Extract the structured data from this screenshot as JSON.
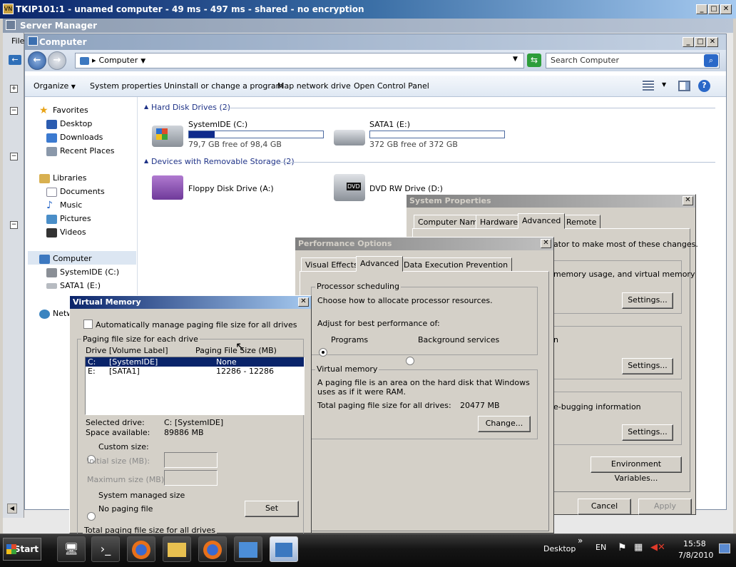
{
  "vnc": {
    "title": "TKIP101:1 - unamed computer - 49 ms - 497 ms - shared - no encryption",
    "logo": "VN"
  },
  "server_manager": {
    "title": "Server Manager",
    "menu_first": "File"
  },
  "explorer": {
    "title": "Computer",
    "address": "Computer",
    "search_placeholder": "Search Computer",
    "toolbar": {
      "organize": "Organize",
      "system_properties": "System properties",
      "uninstall": "Uninstall or change a program",
      "map_drive": "Map network drive",
      "control_panel": "Open Control Panel"
    },
    "nav": {
      "favorites": "Favorites",
      "desktop": "Desktop",
      "downloads": "Downloads",
      "recent": "Recent Places",
      "libraries": "Libraries",
      "documents": "Documents",
      "music": "Music",
      "pictures": "Pictures",
      "videos": "Videos",
      "computer": "Computer",
      "system_ide": "SystemIDE (C:)",
      "sata1": "SATA1 (E:)",
      "network": "Network"
    },
    "groups": {
      "hdd": "Hard Disk Drives (2)",
      "removable": "Devices with Removable Storage (2)"
    },
    "drives": {
      "c": {
        "name": "SystemIDE (C:)",
        "free": "79,7 GB free of 98,4 GB",
        "used_fraction": 0.19
      },
      "e": {
        "name": "SATA1 (E:)",
        "free": "372 GB free of 372 GB",
        "used_fraction": 0.0
      },
      "floppy": {
        "name": "Floppy Disk Drive (A:)"
      },
      "dvd": {
        "name": "DVD RW Drive (D:)",
        "badge": "DVD"
      }
    }
  },
  "system_properties": {
    "title": "System Properties",
    "tabs": [
      "Computer Name",
      "Hardware",
      "Advanced",
      "Remote"
    ],
    "admin_text": "ator to make most of these changes.",
    "perf_text": "memory usage, and virtual memory",
    "startup_text": "n",
    "debug_text": "e-bugging information",
    "settings": "Settings...",
    "env_vars": "Environment Variables...",
    "cancel": "Cancel",
    "apply": "Apply"
  },
  "performance_options": {
    "title": "Performance Options",
    "tabs": [
      "Visual Effects",
      "Advanced",
      "Data Execution Prevention"
    ],
    "proc_legend": "Processor scheduling",
    "proc_desc": "Choose how to allocate processor resources.",
    "adjust": "Adjust for best performance of:",
    "programs": "Programs",
    "background": "Background services",
    "vm_legend": "Virtual memory",
    "vm_desc": "A paging file is an area on the hard disk that Windows uses as if it were RAM.",
    "total_label": "Total paging file size for all drives:",
    "total_value": "20477 MB",
    "change": "Change..."
  },
  "virtual_memory": {
    "title": "Virtual Memory",
    "auto_manage": "Automatically manage paging file size for all drives",
    "paging_legend": "Paging file size for each drive",
    "col_drive": "Drive  [Volume Label]",
    "col_size": "Paging File Size (MB)",
    "rows": [
      {
        "drive": "C:",
        "label": "[SystemIDE]",
        "size": "None"
      },
      {
        "drive": "E:",
        "label": "[SATA1]",
        "size": "12286 - 12286"
      }
    ],
    "selected_label": "Selected drive:",
    "selected_value": "C:  [SystemIDE]",
    "space_label": "Space available:",
    "space_value": "89886 MB",
    "custom": "Custom size:",
    "initial": "Initial size (MB):",
    "maximum": "Maximum size (MB):",
    "system_managed": "System managed size",
    "no_paging": "No paging file",
    "set": "Set",
    "total_legend": "Total paging file size for all drives"
  },
  "taskbar": {
    "start": "Start",
    "desktop": "Desktop",
    "lang": "EN",
    "time": "15:58",
    "date": "7/8/2010"
  }
}
